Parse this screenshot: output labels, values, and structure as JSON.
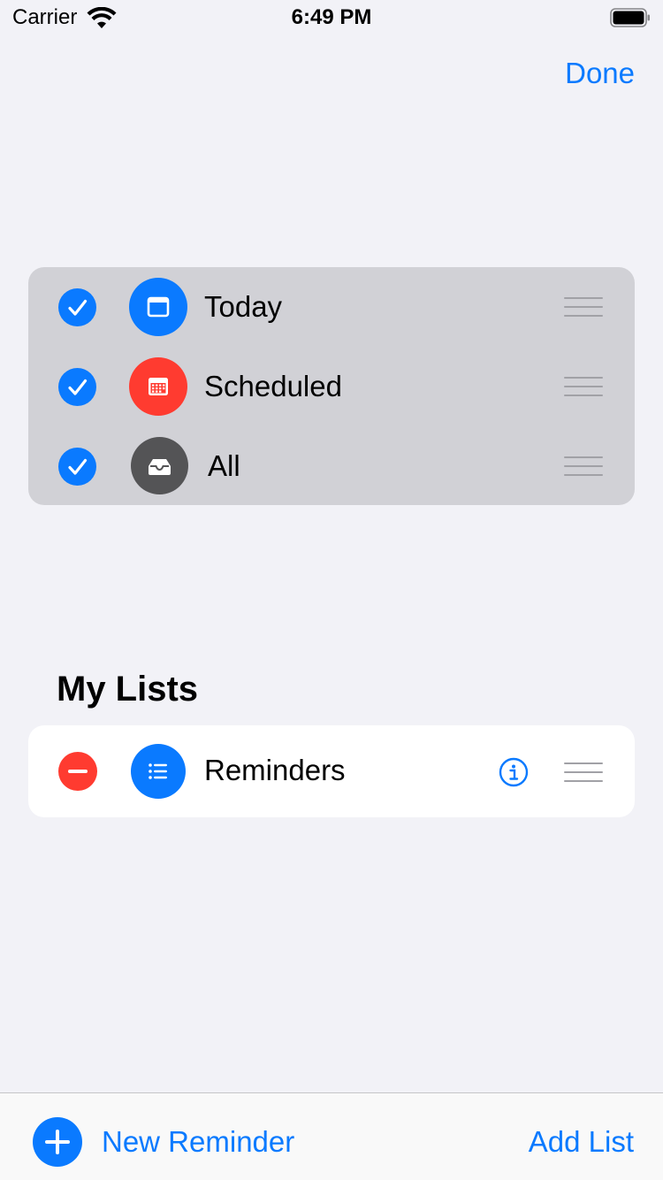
{
  "status_bar": {
    "carrier": "Carrier",
    "time": "6:49 PM"
  },
  "nav": {
    "done_label": "Done"
  },
  "smart_lists": [
    {
      "label": "Today",
      "checked": true,
      "icon": "calendar-today-icon",
      "color": "#0a7aff"
    },
    {
      "label": "Scheduled",
      "checked": true,
      "icon": "calendar-grid-icon",
      "color": "#ff3b30"
    },
    {
      "label": "All",
      "checked": true,
      "icon": "tray-icon",
      "color": "#545456"
    }
  ],
  "my_lists": {
    "title": "My Lists",
    "items": [
      {
        "label": "Reminders",
        "icon": "list-bullet-icon",
        "color": "#0a7aff"
      }
    ]
  },
  "toolbar": {
    "new_reminder_label": "New Reminder",
    "add_list_label": "Add List"
  },
  "colors": {
    "accent": "#0a7aff",
    "destructive": "#ff3b30",
    "background": "#f2f2f7"
  }
}
